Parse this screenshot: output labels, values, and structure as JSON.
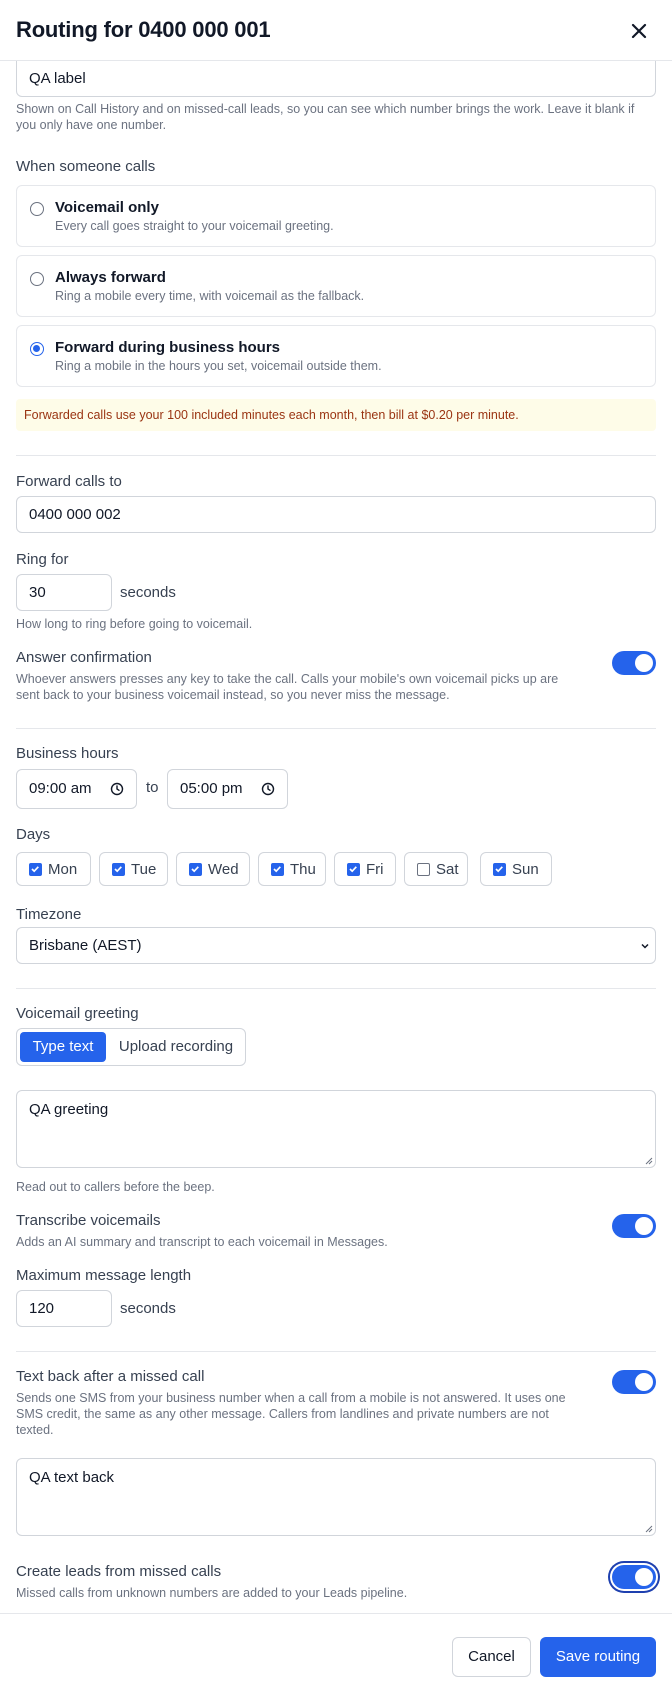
{
  "header": {
    "title": "Routing for 0400 000 001"
  },
  "label_field": {
    "value": "QA label",
    "help": "Shown on Call History and on missed-call leads, so you can see which number brings the work. Leave it blank if you only have one number."
  },
  "routing": {
    "heading": "When someone calls",
    "options": [
      {
        "title": "Voicemail only",
        "desc": "Every call goes straight to your voicemail greeting.",
        "selected": false
      },
      {
        "title": "Always forward",
        "desc": "Ring a mobile every time, with voicemail as the fallback.",
        "selected": false
      },
      {
        "title": "Forward during business hours",
        "desc": "Ring a mobile in the hours you set, voicemail outside them.",
        "selected": true
      }
    ],
    "notice": "Forwarded calls use your 100 included minutes each month, then bill at $0.20 per minute."
  },
  "forward": {
    "label": "Forward calls to",
    "value": "0400 000 002",
    "ring_label": "Ring for",
    "ring_value": "30",
    "ring_unit": "seconds",
    "ring_help": "How long to ring before going to voicemail.",
    "confirm_label": "Answer confirmation",
    "confirm_help": "Whoever answers presses any key to take the call. Calls your mobile's own voicemail picks up are sent back to your business voicemail instead, so you never miss the message.",
    "confirm_on": true
  },
  "hours": {
    "label": "Business hours",
    "start": "09:00 am",
    "to": "to",
    "end": "05:00 pm",
    "days_label": "Days",
    "days": [
      {
        "label": "Mon",
        "checked": true
      },
      {
        "label": "Tue",
        "checked": true
      },
      {
        "label": "Wed",
        "checked": true
      },
      {
        "label": "Thu",
        "checked": true
      },
      {
        "label": "Fri",
        "checked": true
      },
      {
        "label": "Sat",
        "checked": false
      },
      {
        "label": "Sun",
        "checked": true
      }
    ],
    "timezone_label": "Timezone",
    "timezone": "Brisbane (AEST)"
  },
  "voicemail": {
    "label": "Voicemail greeting",
    "tab_text": "Type text",
    "tab_upload": "Upload recording",
    "greeting": "QA greeting",
    "greeting_help": "Read out to callers before the beep.",
    "transcribe_label": "Transcribe voicemails",
    "transcribe_help": "Adds an AI summary and transcript to each voicemail in Messages.",
    "transcribe_on": true,
    "maxlen_label": "Maximum message length",
    "maxlen_value": "120",
    "maxlen_unit": "seconds"
  },
  "textback": {
    "label": "Text back after a missed call",
    "help": "Sends one SMS from your business number when a call from a mobile is not answered. It uses one SMS credit, the same as any other message. Callers from landlines and private numbers are not texted.",
    "on": true,
    "message": "QA text back"
  },
  "leads": {
    "label": "Create leads from missed calls",
    "help": "Missed calls from unknown numbers are added to your Leads pipeline.",
    "on": true
  },
  "footer": {
    "cancel": "Cancel",
    "save": "Save routing"
  },
  "colors": {
    "accent": "#2563eb",
    "notice_bg": "#fefce8",
    "notice_text": "#9a3412"
  }
}
